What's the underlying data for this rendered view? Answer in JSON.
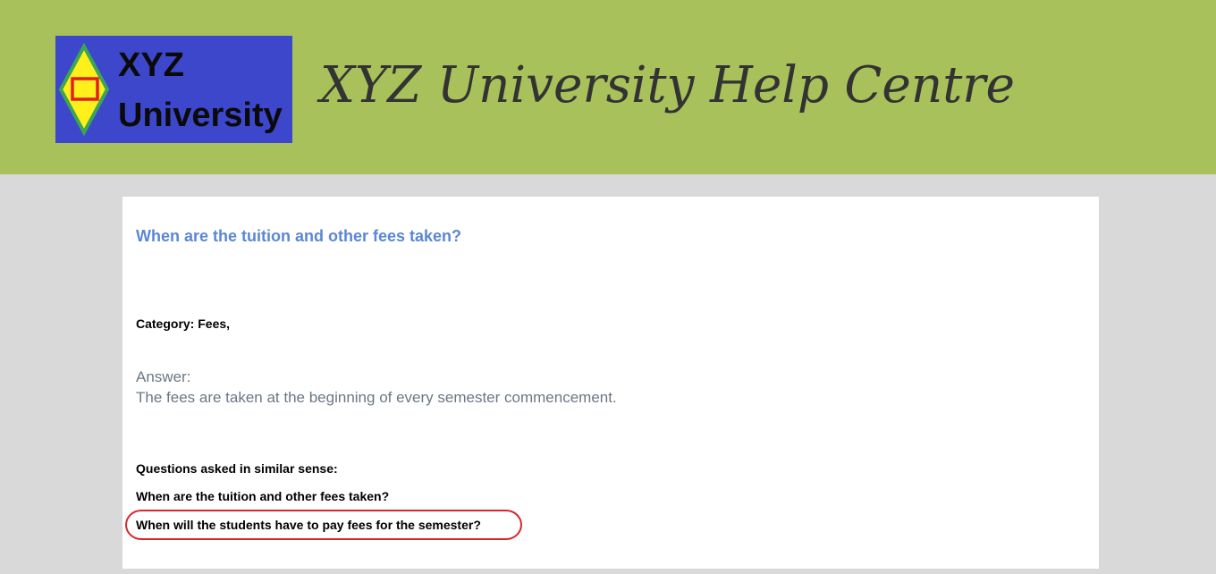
{
  "header": {
    "logo": {
      "line1": "XYZ",
      "line2": "University",
      "colors": {
        "background": "#3d47cc",
        "diamond_fill": "#ffef1a",
        "diamond_stroke": "#3aa655",
        "square_stroke": "#e02020"
      }
    },
    "title": "XYZ University Help Centre",
    "background_color": "#a9c15a"
  },
  "article": {
    "question": "When are the tuition and other fees taken?",
    "category": "Category: Fees,",
    "answer_label": "Answer:",
    "answer_text": "The fees are taken at the beginning of every semester commencement.",
    "similar": {
      "heading": "Questions asked in similar sense:",
      "items": [
        "When are the tuition and other fees taken?",
        "When will the students have to pay fees for the semester?"
      ],
      "highlighted_item": "When will the students have to pay fees for the semester?",
      "highlight_color": "#d8262c"
    }
  },
  "colors": {
    "page_background": "#d9d9d9",
    "question_title": "#5b87d4",
    "answer_text": "#6b7785"
  }
}
